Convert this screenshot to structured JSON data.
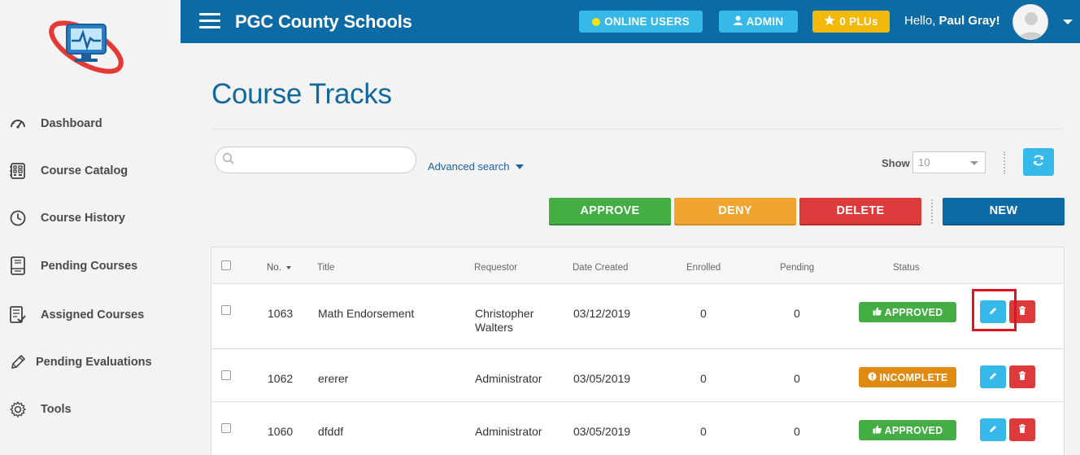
{
  "header": {
    "title": "PGC County Schools",
    "online_users": "ONLINE USERS",
    "admin": "ADMIN",
    "plus": "0 PLUs",
    "greeting": "Hello,",
    "user_name": "Paul Gray!"
  },
  "sidebar": {
    "items": [
      {
        "label": "Dashboard",
        "icon": "gauge-icon"
      },
      {
        "label": "Course Catalog",
        "icon": "catalog-icon"
      },
      {
        "label": "Course History",
        "icon": "clock-icon"
      },
      {
        "label": "Pending Courses",
        "icon": "book-icon"
      },
      {
        "label": "Assigned Courses",
        "icon": "assigned-icon"
      },
      {
        "label": "Pending Evaluations",
        "icon": "pencil-icon"
      },
      {
        "label": "Tools",
        "icon": "gear-icon"
      }
    ]
  },
  "main": {
    "title": "Course Tracks",
    "search_placeholder": "",
    "advanced_search": "Advanced search",
    "show_label": "Show",
    "show_value": "10",
    "actions": {
      "approve": "APPROVE",
      "deny": "DENY",
      "delete": "DELETE",
      "new": "NEW"
    }
  },
  "table": {
    "columns": [
      "No.",
      "Title",
      "Requestor",
      "Date Created",
      "Enrolled",
      "Pending",
      "Status"
    ],
    "rows": [
      {
        "no": "1063",
        "title": "Math Endorsement",
        "requestor_line1": "Christopher",
        "requestor_line2": "Walters",
        "date": "03/12/2019",
        "enrolled": "0",
        "pending": "0",
        "status": "APPROVED"
      },
      {
        "no": "1062",
        "title": "ererer",
        "requestor_line1": "Administrator",
        "requestor_line2": "",
        "date": "03/05/2019",
        "enrolled": "0",
        "pending": "0",
        "status": "INCOMPLETE"
      },
      {
        "no": "1060",
        "title": "dfddf",
        "requestor_line1": "Administrator",
        "requestor_line2": "",
        "date": "03/05/2019",
        "enrolled": "0",
        "pending": "0",
        "status": "APPROVED"
      }
    ]
  },
  "colors": {
    "brand": "#0c6aa5",
    "info": "#36b9e8",
    "success": "#44ad43",
    "warning": "#f0a531",
    "danger": "#dd3b3b",
    "highlight": "#e0141e"
  }
}
